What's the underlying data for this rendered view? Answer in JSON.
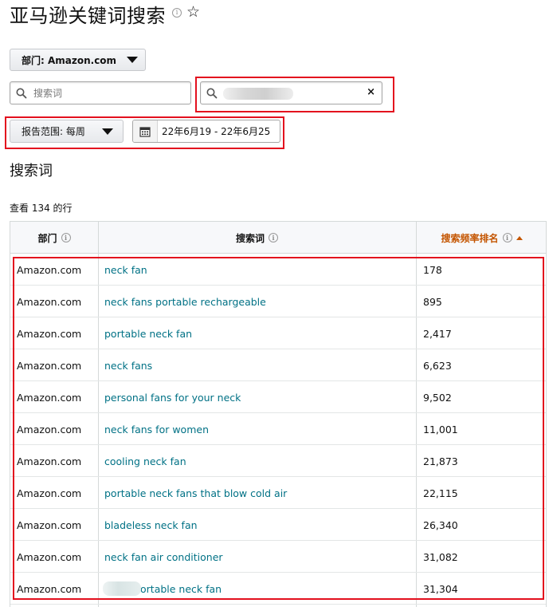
{
  "page": {
    "title": "亚马逊关键词搜索",
    "info_glyph": "i",
    "star_glyph": "☆"
  },
  "filters": {
    "department_label": "部门: Amazon.com",
    "search_placeholder": "搜索词",
    "clear_glyph": "×",
    "report_range_label": "报告范围: 每周",
    "date_range": "22年6月19 - 22年6月25"
  },
  "results": {
    "section_title": "搜索词",
    "count_text": "查看 134 的行"
  },
  "table": {
    "columns": [
      "部门",
      "搜索词",
      "搜索频率排名"
    ],
    "rows": [
      {
        "dept": "Amazon.com",
        "term": "neck fan",
        "rank": "178"
      },
      {
        "dept": "Amazon.com",
        "term": "neck fans portable rechargeable",
        "rank": "895"
      },
      {
        "dept": "Amazon.com",
        "term": "portable neck fan",
        "rank": "2,417"
      },
      {
        "dept": "Amazon.com",
        "term": "neck fans",
        "rank": "6,623"
      },
      {
        "dept": "Amazon.com",
        "term": "personal fans for your neck",
        "rank": "9,502"
      },
      {
        "dept": "Amazon.com",
        "term": "neck fans for women",
        "rank": "11,001"
      },
      {
        "dept": "Amazon.com",
        "term": "cooling neck fan",
        "rank": "21,873"
      },
      {
        "dept": "Amazon.com",
        "term": "portable neck fans that blow cold air",
        "rank": "22,115"
      },
      {
        "dept": "Amazon.com",
        "term": "bladeless neck fan",
        "rank": "26,340"
      },
      {
        "dept": "Amazon.com",
        "term": "neck fan air conditioner",
        "rank": "31,082"
      },
      {
        "dept": "Amazon.com",
        "term": "ortable neck fan",
        "rank": "31,304"
      }
    ]
  },
  "colors": {
    "link": "#007185",
    "sorted_header": "#c45500",
    "highlight_box": "#e3101e"
  }
}
